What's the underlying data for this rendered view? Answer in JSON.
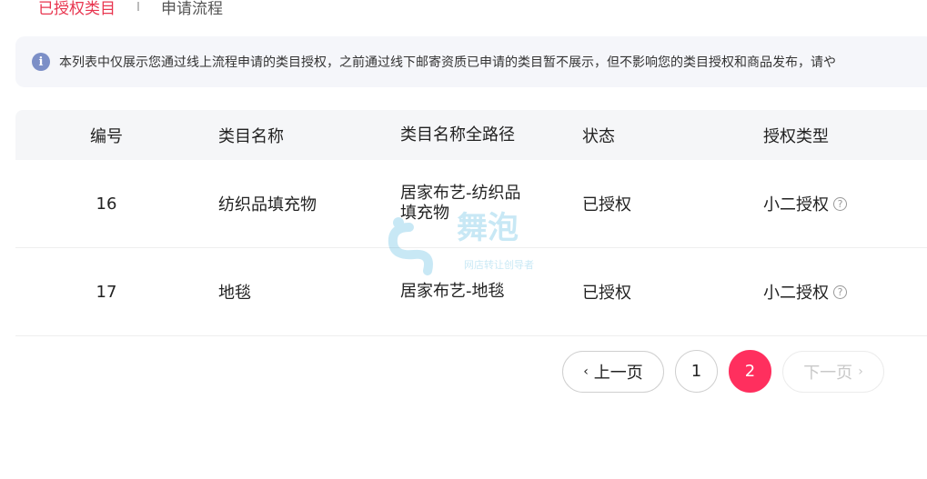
{
  "tabs": {
    "active": "已授权类目",
    "other": "申请流程"
  },
  "notice": {
    "icon": "info-icon",
    "text": "本列表中仅展示您通过线上流程申请的类目授权，之前通过线下邮寄资质已申请的类目暂不展示，但不影响您的类目授权和商品发布，请や"
  },
  "table": {
    "headers": [
      "编号",
      "类目名称",
      "类目名称全路径",
      "状态",
      "授权类型"
    ],
    "rows": [
      {
        "id": "16",
        "name": "纺织品填充物",
        "path": "居家布艺-纺织品填充物",
        "status": "已授权",
        "auth_type": "小二授权"
      },
      {
        "id": "17",
        "name": "地毯",
        "path": "居家布艺-地毯",
        "status": "已授权",
        "auth_type": "小二授权"
      }
    ]
  },
  "pagination": {
    "prev": "上一页",
    "pages": [
      "1",
      "2"
    ],
    "current": "2",
    "next": "下一页"
  },
  "watermark": {
    "brand": "舞泡",
    "slogan": "网店转让创导者"
  },
  "colors": {
    "accent": "#ff2f5e",
    "tab_active": "#e8354f",
    "info_icon": "#7c8fc7"
  }
}
